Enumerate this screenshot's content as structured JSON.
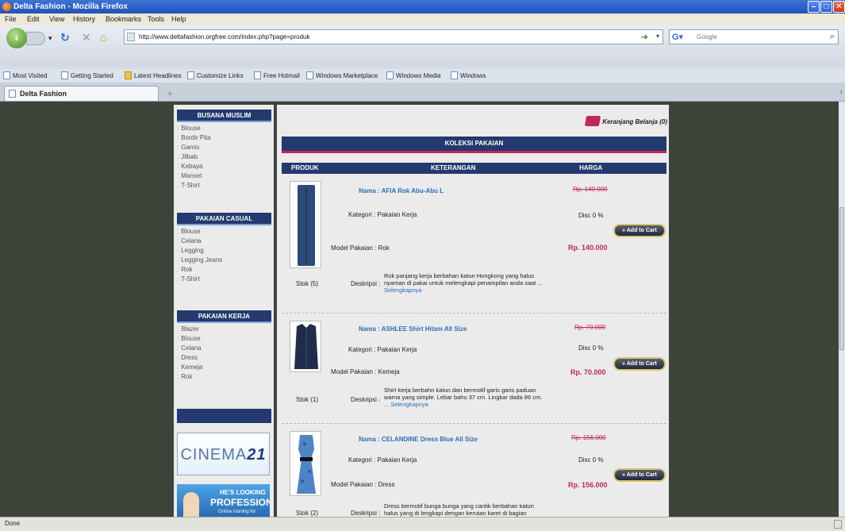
{
  "window": {
    "title": "Delta Fashion - Mozilla Firefox"
  },
  "menu": [
    "File",
    "Edit",
    "View",
    "History",
    "Bookmarks",
    "Tools",
    "Help"
  ],
  "url": "http://www.deltafashion.orgfree.com/index.php?page=produk",
  "search_placeholder": "Google",
  "bookmarks": [
    "Most Visited",
    "Getting Started",
    "Latest Headlines",
    "Customize Links",
    "Free Hotmail",
    "Windows Marketplace",
    "Windows Media",
    "Windows"
  ],
  "tab": {
    "label": "Delta Fashion"
  },
  "status": "Done",
  "sidebar": {
    "categories": [
      {
        "title": "BUSANA MUSLIM",
        "items": [
          "Blouse",
          "Bordir Pita",
          "Gamis",
          "Jilbab",
          "Kebaya",
          "Manset",
          "T-Shirt"
        ]
      },
      {
        "title": "PAKAIAN CASUAL",
        "items": [
          "Blouse",
          "Celana",
          "Legging",
          "Legging Jeans",
          "Rok",
          "T-Shirt"
        ]
      },
      {
        "title": "PAKAIAN KERJA",
        "items": [
          "Blazer",
          "Blouse",
          "Celana",
          "Dress",
          "Kemeja",
          "Rok"
        ]
      }
    ],
    "banner_cinema": {
      "text1": "CINEMA",
      "text2": "21"
    },
    "banner_pro": {
      "line1": "HE'S LOOKING",
      "line2": "PROFESSIONAL",
      "line3": "Online training for"
    }
  },
  "main": {
    "cart": "Keranjang Belanja (0)",
    "title": "KOLEKSI PAKAIAN",
    "columns": [
      "PRODUK",
      "KETERANGAN",
      "HARGA"
    ],
    "labels": {
      "nama": "Nama :",
      "kategori": "Kategori :",
      "model": "Model Pakaian :",
      "deskripsi": "Deskripsi :",
      "disc": "Disc",
      "add_to_cart": "Add to Cart",
      "more": "Selengkapnya"
    },
    "products": [
      {
        "nama": "AFIA Rok Abu-Abu L",
        "kategori": "Pakaian Kerja",
        "model": "Rok",
        "price_old": "Rp. 140.000",
        "disc": "Disc 0 %",
        "price": "Rp. 140.000",
        "stok": "Stok (5)",
        "desc1": "Rok panjang kerja berbahan katun Hongkong yang halus",
        "desc2": "nyaman di pakai untuk melengkapi penampilan anda saat ...",
        "more": "Selengkapnya"
      },
      {
        "nama": "ASHLEE Shirt Hitam All Size",
        "kategori": "Pakaian Kerja",
        "model": "Kemeja",
        "price_old": "Rp. 70.000",
        "disc": "Disc 0 %",
        "price": "Rp. 70.000",
        "stok": "Stok (1)",
        "desc1": "Shirt kerja berbahn katun dan bermotif garis garis paduan",
        "desc2": "warna yang simple. Lebar bahu 37 cm. Lingkar dada 86 cm.",
        "more": "... Selengkapnya"
      },
      {
        "nama": "CELANDINE Dress Blue All Size",
        "kategori": "Pakaian Kerja",
        "model": "Dress",
        "price_old": "Rp. 156.000",
        "disc": "Disc 0 %",
        "price": "Rp. 156.000",
        "stok": "Stok (2)",
        "desc1": "Dress bermotif bunga bunga yang cantik berbahan katun",
        "desc2": "halus yang di lengkapi dengan kerutan karet di bagian",
        "more": ""
      }
    ]
  }
}
